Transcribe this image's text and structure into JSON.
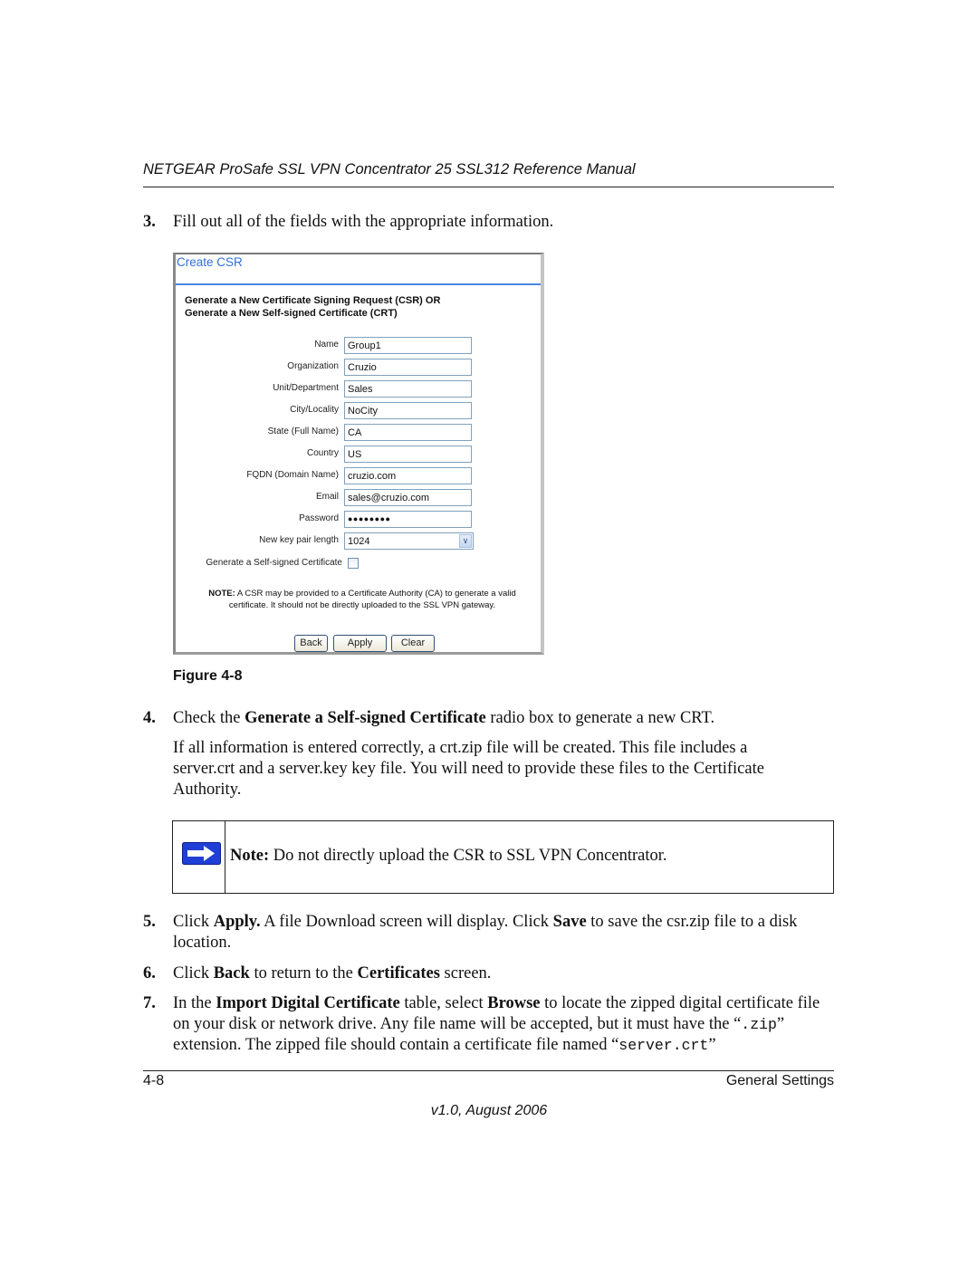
{
  "header": {
    "title": "NETGEAR ProSafe SSL VPN Concentrator 25 SSL312 Reference Manual"
  },
  "steps": {
    "s3": {
      "num": "3.",
      "text": "Fill out all of the fields with the appropriate information."
    },
    "s4": {
      "num": "4.",
      "pre": "Check the ",
      "bold": "Generate a Self-signed Certificate",
      "post": " radio box to generate a new CRT."
    },
    "s4_para": "If all information is entered correctly, a crt.zip file will be created. This file includes a server.crt and a server.key key file. You will need to provide these files to the Certificate Authority.",
    "s5": {
      "num": "5.",
      "t1": "Click ",
      "b1": "Apply.",
      "t2": " A file Download screen will display. Click ",
      "b2": "Save",
      "t3": " to save the csr.zip file to a disk location."
    },
    "s6": {
      "num": "6.",
      "t1": "Click ",
      "b1": "Back",
      "t2": " to return to the ",
      "b2": "Certificates",
      "t3": " screen."
    },
    "s7": {
      "num": "7.",
      "t1": "In the ",
      "b1": "Import Digital Certificate",
      "t2": " table, select ",
      "b2": "Browse",
      "t3": " to locate the zipped digital certificate file on your disk or network drive. Any file name will be accepted, but it must have the “",
      "m1": ".zip",
      "t4": "” extension. The zipped file should contain a certificate file named “",
      "m2": "server.crt",
      "t5": "”"
    }
  },
  "screenshot": {
    "title": "Create CSR",
    "intro_line1": "Generate a New Certificate Signing Request (CSR) OR",
    "intro_line2": "Generate a New Self-signed Certificate (CRT)",
    "fields": [
      {
        "label": "Name",
        "value": "Group1"
      },
      {
        "label": "Organization",
        "value": "Cruzio"
      },
      {
        "label": "Unit/Department",
        "value": "Sales"
      },
      {
        "label": "City/Locality",
        "value": "NoCity"
      },
      {
        "label": "State (Full Name)",
        "value": "CA"
      },
      {
        "label": "Country",
        "value": "US"
      },
      {
        "label": "FQDN (Domain Name)",
        "value": "cruzio.com"
      },
      {
        "label": "Email",
        "value": "sales@cruzio.com"
      },
      {
        "label": "Password",
        "value": "●●●●●●●●"
      }
    ],
    "key_length": {
      "label": "New key pair length",
      "value": "1024"
    },
    "self_signed": {
      "label": "Generate a Self-signed Certificate",
      "checked": false
    },
    "note_bold": "NOTE:",
    "note_line1": " A CSR may be provided to a Certificate Authority (CA) to generate a valid",
    "note_line2": "certificate. It should not be directly uploaded to the SSL VPN gateway.",
    "buttons": {
      "back": "Back",
      "apply": "Apply",
      "clear": "Clear"
    }
  },
  "figure_caption": "Figure 4-8",
  "note_box": {
    "icon": "right-arrow-icon",
    "bold": "Note:",
    "text": " Do not directly upload the CSR to SSL VPN Concentrator."
  },
  "footer": {
    "page": "4-8",
    "section": "General Settings",
    "version": "v1.0, August 2006"
  }
}
